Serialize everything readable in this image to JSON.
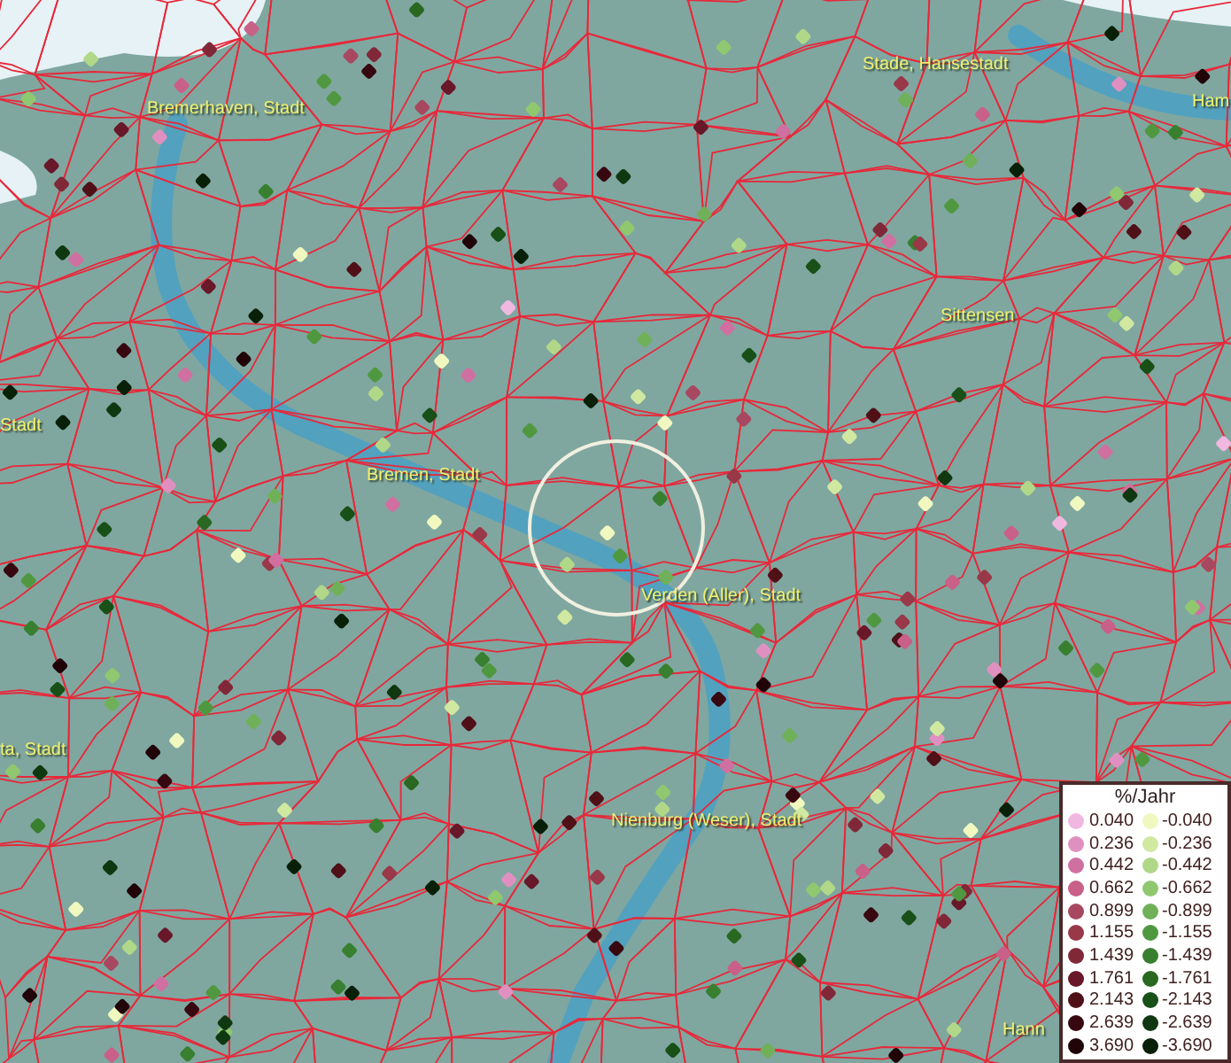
{
  "map": {
    "place_labels": [
      "Bremerhaven, Stadt",
      "Stade, Hansestadt",
      "Ham",
      "Sittensen",
      "Stadt",
      "Bremen, Stadt",
      "Verden (Aller), Stadt",
      "ta, Stadt",
      "Nienburg (Weser), Stadt",
      "Hann"
    ]
  },
  "legend": {
    "title": "%/Jahr",
    "rows": [
      {
        "positive": {
          "value": "0.040",
          "color": "#f0b8e0"
        },
        "negative": {
          "value": "-0.040",
          "color": "#f0f8c0"
        }
      },
      {
        "positive": {
          "value": "0.236",
          "color": "#e090c0"
        },
        "negative": {
          "value": "-0.236",
          "color": "#d0e8a0"
        }
      },
      {
        "positive": {
          "value": "0.442",
          "color": "#d070a0"
        },
        "negative": {
          "value": "-0.442",
          "color": "#b0d888"
        }
      },
      {
        "positive": {
          "value": "0.662",
          "color": "#c86088"
        },
        "negative": {
          "value": "-0.662",
          "color": "#90c870"
        }
      },
      {
        "positive": {
          "value": "0.899",
          "color": "#a84860"
        },
        "negative": {
          "value": "-0.899",
          "color": "#70b058"
        }
      },
      {
        "positive": {
          "value": "1.155",
          "color": "#983848"
        },
        "negative": {
          "value": "-1.155",
          "color": "#509840"
        }
      },
      {
        "positive": {
          "value": "1.439",
          "color": "#802838"
        },
        "negative": {
          "value": "-1.439",
          "color": "#388030"
        }
      },
      {
        "positive": {
          "value": "1.761",
          "color": "#681828"
        },
        "negative": {
          "value": "-1.761",
          "color": "#286820"
        }
      },
      {
        "positive": {
          "value": "2.143",
          "color": "#501018"
        },
        "negative": {
          "value": "-2.143",
          "color": "#185018"
        }
      },
      {
        "positive": {
          "value": "2.639",
          "color": "#380810"
        },
        "negative": {
          "value": "-2.639",
          "color": "#103810"
        }
      },
      {
        "positive": {
          "value": "3.690",
          "color": "#200408"
        },
        "negative": {
          "value": "-3.690",
          "color": "#082008"
        }
      }
    ]
  }
}
